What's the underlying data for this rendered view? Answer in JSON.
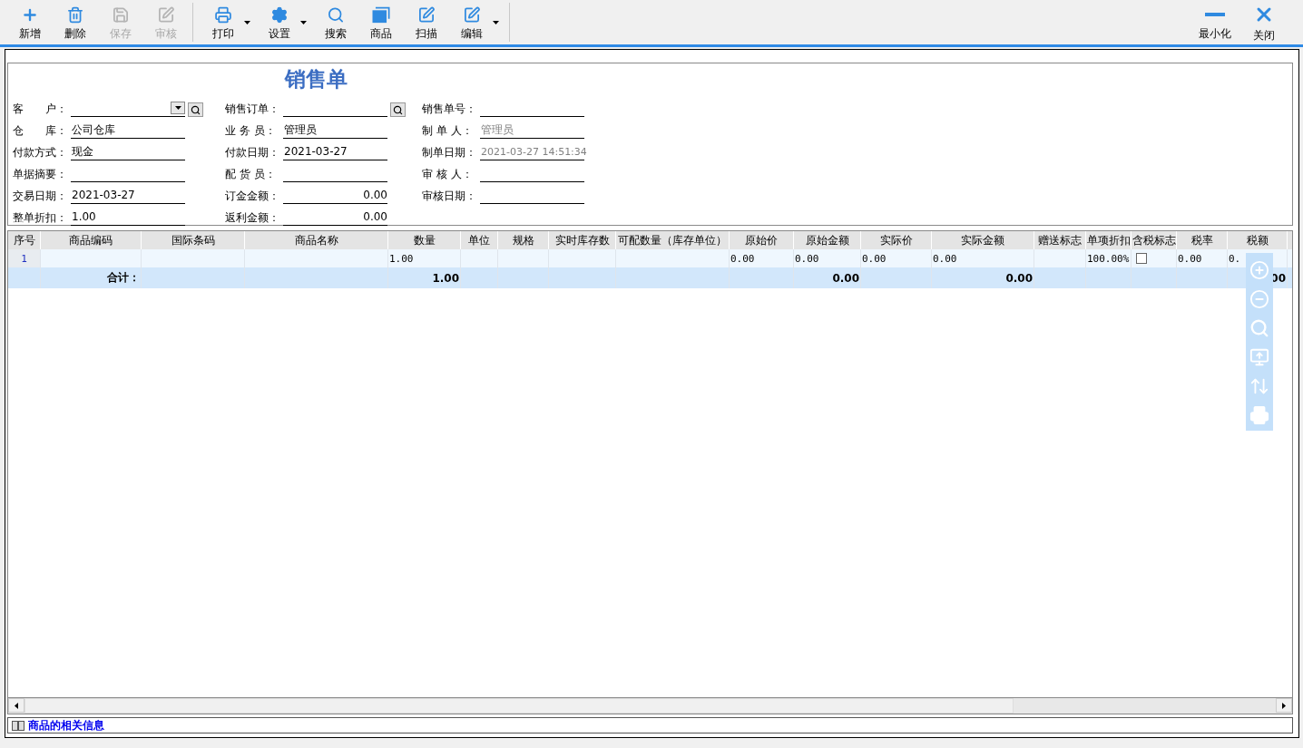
{
  "toolbar": {
    "groups": [
      [
        {
          "label": "新增",
          "kind": "add",
          "disabled": false
        },
        {
          "label": "删除",
          "kind": "delete",
          "disabled": false
        },
        {
          "label": "保存",
          "kind": "save",
          "disabled": true
        },
        {
          "label": "审核",
          "kind": "audit",
          "disabled": true
        }
      ],
      [
        {
          "label": "打印",
          "kind": "print",
          "disabled": false,
          "menu": true
        },
        {
          "label": "设置",
          "kind": "settings",
          "disabled": false,
          "menu": true
        },
        {
          "label": "搜索",
          "kind": "search",
          "disabled": false
        },
        {
          "label": "商品",
          "kind": "goods",
          "disabled": false
        },
        {
          "label": "扫描",
          "kind": "scan",
          "disabled": false
        },
        {
          "label": "编辑",
          "kind": "edit",
          "disabled": false,
          "menu": true
        }
      ]
    ],
    "window_buttons": [
      {
        "label": "最小化",
        "kind": "minimize"
      },
      {
        "label": "关闭",
        "kind": "close"
      }
    ]
  },
  "form": {
    "title": "销售单",
    "columns": [
      [
        {
          "label": "客　　户：",
          "dropdown": true,
          "lookup": true
        },
        {
          "label": "仓　　库：",
          "value": "公司仓库"
        },
        {
          "label": "付款方式：",
          "value": "现金"
        },
        {
          "label": "单据摘要："
        },
        {
          "label": "交易日期：",
          "value": "2021-03-27"
        },
        {
          "label": "整单折扣：",
          "value": "1.00"
        }
      ],
      [
        {
          "label": "销售订单：",
          "lookup": true
        },
        {
          "label": "业 务 员：",
          "value": "管理员"
        },
        {
          "label": "付款日期：",
          "value": "2021-03-27"
        },
        {
          "label": "配 货 员："
        },
        {
          "label": "订金金额：",
          "value": "0.00",
          "numeric": true
        },
        {
          "label": "返利金额：",
          "value": "0.00",
          "numeric": true
        }
      ],
      [
        {
          "label": "销售单号："
        },
        {
          "label": "制 单 人：",
          "value": "管理员",
          "muted": true
        },
        {
          "label": "制单日期：",
          "value": "2021-03-27 14:51:34",
          "muted": true
        },
        {
          "label": "审 核 人："
        },
        {
          "label": "审核日期："
        }
      ]
    ]
  },
  "table": {
    "columns": [
      "序号",
      "商品编码",
      "国际条码",
      "商品名称",
      "数量",
      "单位",
      "规格",
      "实时库存数",
      "可配数量（库存单位）",
      "原始价",
      "原始金额",
      "实际价",
      "实际金额",
      "赠送标志",
      "单项折扣",
      "含税标志",
      "税率",
      "税额"
    ],
    "rows": [
      {
        "kind": "data",
        "cells": [
          "1",
          null,
          null,
          null,
          "1.00",
          null,
          null,
          null,
          null,
          "0.00",
          "0.00",
          "0.00",
          "0.00",
          null,
          "100.00%",
          {
            "checked": false
          },
          "0.00",
          "0."
        ]
      },
      {
        "kind": "total",
        "cells": [
          null,
          "合计：",
          null,
          null,
          "1.00",
          null,
          null,
          null,
          null,
          null,
          "0.00",
          null,
          "0.00",
          null,
          null,
          null,
          null,
          "00"
        ]
      }
    ]
  },
  "info_link": "商品的相关信息"
}
